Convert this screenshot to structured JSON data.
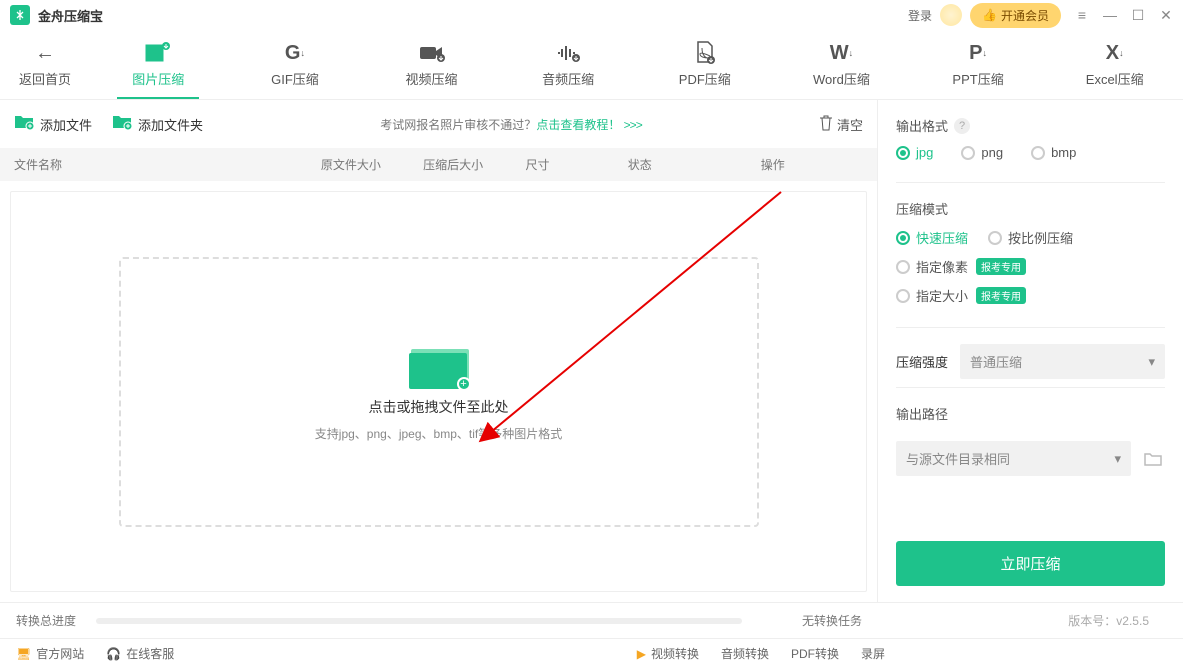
{
  "app": {
    "title": "金舟压缩宝"
  },
  "titlebar": {
    "login": "登录",
    "vip": "开通会员"
  },
  "tabs": {
    "back": "返回首页",
    "image": "图片压缩",
    "gif": "GIF压缩",
    "video": "视频压缩",
    "audio": "音频压缩",
    "pdf": "PDF压缩",
    "word": "Word压缩",
    "ppt": "PPT压缩",
    "excel": "Excel压缩"
  },
  "toolbar": {
    "add_file": "添加文件",
    "add_folder": "添加文件夹",
    "promo_prefix": "考试网报名照片审核不通过？",
    "promo_link": "点击查看教程！",
    "promo_arrows": ">>>",
    "clear": "清空"
  },
  "list": {
    "name": "文件名称",
    "orig": "原文件大小",
    "new": "压缩后大小",
    "dim": "尺寸",
    "stat": "状态",
    "op": "操作"
  },
  "drop": {
    "line1": "点击或拖拽文件至此处",
    "line2": "支持jpg、png、jpeg、bmp、tif等多种图片格式"
  },
  "panel": {
    "out_format": "输出格式",
    "fmt_jpg": "jpg",
    "fmt_png": "png",
    "fmt_bmp": "bmp",
    "mode": "压缩模式",
    "mode_fast": "快速压缩",
    "mode_ratio": "按比例压缩",
    "mode_pixel": "指定像素",
    "mode_size": "指定大小",
    "badge": "报考专用",
    "strength": "压缩强度",
    "strength_value": "普通压缩",
    "out_path": "输出路径",
    "path_value": "与源文件目录相同",
    "compress": "立即压缩"
  },
  "progress": {
    "label": "转换总进度",
    "status": "无转换任务"
  },
  "version": {
    "label": "版本号：v2.5.5"
  },
  "bottom": {
    "site": "官方网站",
    "support": "在线客服",
    "vconv": "视频转换",
    "aconv": "音频转换",
    "pconv": "PDF转换",
    "screen": "录屏"
  }
}
